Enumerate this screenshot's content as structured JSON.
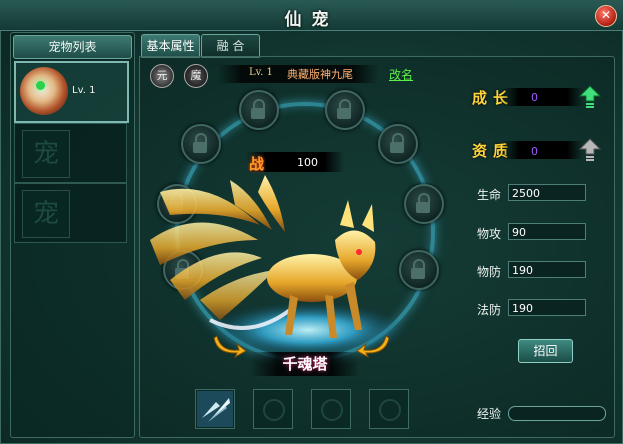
{
  "window": {
    "title": "仙宠",
    "close_glyph": "✕"
  },
  "left_panel": {
    "header": "宠物列表",
    "pets": [
      {
        "level": "Lv. 1",
        "selected": true
      }
    ],
    "empty_slot_glyph": "宠"
  },
  "tabs": [
    {
      "label": "基本属性",
      "active": true
    },
    {
      "label": "融 合",
      "active": false
    }
  ],
  "pet_header": {
    "icon_left": "元",
    "icon_right": "魔",
    "level": "Lv. 1",
    "name": "典藏版神九尾",
    "rename_link": "改名"
  },
  "battle": {
    "icon": "战",
    "value": "100"
  },
  "platform_label": "千魂塔",
  "stats": {
    "growth": {
      "label": "成长",
      "value": "0"
    },
    "quality": {
      "label": "资质",
      "value": "0"
    }
  },
  "attributes": [
    {
      "label": "生命",
      "value": "2500"
    },
    {
      "label": "物攻",
      "value": "90"
    },
    {
      "label": "物防",
      "value": "190"
    },
    {
      "label": "法防",
      "value": "190"
    }
  ],
  "recall_button": "招回",
  "experience": {
    "label": "经验",
    "fraction": 0
  },
  "colors": {
    "accent": "#ffd43a",
    "rename_link": "#5cf04a",
    "stat_value": "#a05cff",
    "ring_glow": "#46c8e6"
  }
}
